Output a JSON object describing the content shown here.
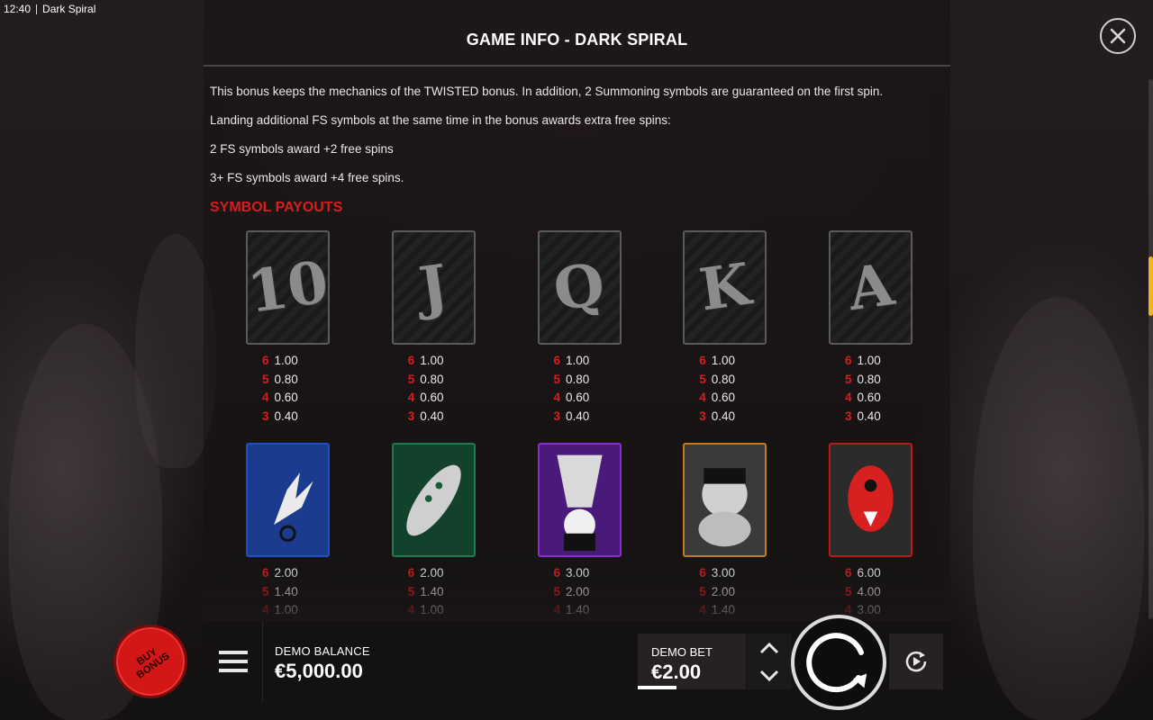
{
  "status_bar": {
    "time": "12:40",
    "app_name": "Dark Spiral"
  },
  "dialog": {
    "title": "GAME INFO - DARK SPIRAL",
    "close_icon": "close-icon"
  },
  "content": {
    "paragraphs": [
      "This bonus keeps the mechanics of the TWISTED bonus. In addition, 2 Summoning symbols are guaranteed on the first spin.",
      "Landing additional FS symbols at the same time in the bonus awards extra free spins:",
      "2 FS symbols award +2 free spins",
      "3+ FS symbols award +4 free spins."
    ],
    "section_title": "SYMBOL PAYOUTS",
    "low_symbols": [
      {
        "glyph": "10",
        "payouts": [
          {
            "count": "6",
            "value": "1.00"
          },
          {
            "count": "5",
            "value": "0.80"
          },
          {
            "count": "4",
            "value": "0.60"
          },
          {
            "count": "3",
            "value": "0.40"
          }
        ]
      },
      {
        "glyph": "J",
        "payouts": [
          {
            "count": "6",
            "value": "1.00"
          },
          {
            "count": "5",
            "value": "0.80"
          },
          {
            "count": "4",
            "value": "0.60"
          },
          {
            "count": "3",
            "value": "0.40"
          }
        ]
      },
      {
        "glyph": "Q",
        "payouts": [
          {
            "count": "6",
            "value": "1.00"
          },
          {
            "count": "5",
            "value": "0.80"
          },
          {
            "count": "4",
            "value": "0.60"
          },
          {
            "count": "3",
            "value": "0.40"
          }
        ]
      },
      {
        "glyph": "K",
        "payouts": [
          {
            "count": "6",
            "value": "1.00"
          },
          {
            "count": "5",
            "value": "0.80"
          },
          {
            "count": "4",
            "value": "0.60"
          },
          {
            "count": "3",
            "value": "0.40"
          }
        ]
      },
      {
        "glyph": "A",
        "payouts": [
          {
            "count": "6",
            "value": "1.00"
          },
          {
            "count": "5",
            "value": "0.80"
          },
          {
            "count": "4",
            "value": "0.60"
          },
          {
            "count": "3",
            "value": "0.40"
          }
        ]
      }
    ],
    "high_symbols": [
      {
        "name": "hand-symbol",
        "border": "#1f4fc4",
        "bg": "#1b3b8f",
        "payouts": [
          {
            "count": "6",
            "value": "2.00"
          },
          {
            "count": "5",
            "value": "1.40"
          },
          {
            "count": "4",
            "value": "1.00"
          }
        ]
      },
      {
        "name": "centipede-symbol",
        "border": "#1f7a4d",
        "bg": "#12422b",
        "payouts": [
          {
            "count": "6",
            "value": "2.00"
          },
          {
            "count": "5",
            "value": "1.40"
          },
          {
            "count": "4",
            "value": "1.00"
          }
        ]
      },
      {
        "name": "hanging-girl-symbol",
        "border": "#8a2bd1",
        "bg": "#4a1a7a",
        "payouts": [
          {
            "count": "6",
            "value": "3.00"
          },
          {
            "count": "5",
            "value": "2.00"
          },
          {
            "count": "4",
            "value": "1.40"
          }
        ]
      },
      {
        "name": "twisted-face-symbol",
        "border": "#c87a1a",
        "bg": "#3a3a3a",
        "payouts": [
          {
            "count": "6",
            "value": "3.00"
          },
          {
            "count": "5",
            "value": "2.00"
          },
          {
            "count": "4",
            "value": "1.40"
          }
        ]
      },
      {
        "name": "spiral-eye-symbol",
        "border": "#c01818",
        "bg": "#2b2b2b",
        "payouts": [
          {
            "count": "6",
            "value": "6.00"
          },
          {
            "count": "5",
            "value": "4.00"
          },
          {
            "count": "4",
            "value": "3.00"
          }
        ]
      }
    ]
  },
  "controls": {
    "buy_bonus_line1": "BUY",
    "buy_bonus_line2": "BONUS",
    "balance_label": "DEMO BALANCE",
    "balance_value": "€5,000.00",
    "bet_label": "DEMO BET",
    "bet_value": "€2.00"
  },
  "colors": {
    "accent_red": "#d81e1e",
    "scroll_thumb": "#f1b619"
  }
}
